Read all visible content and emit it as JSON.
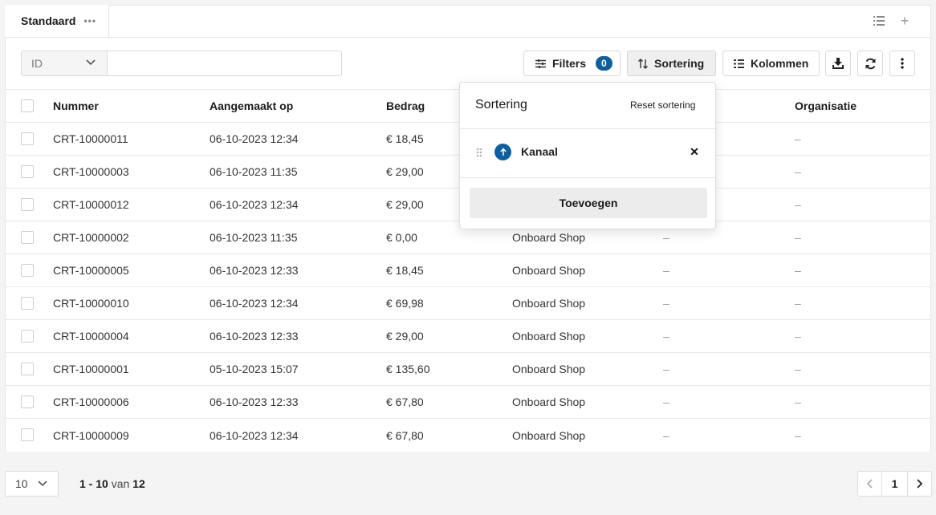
{
  "tabs": {
    "active_label": "Standaard",
    "more_label": "•••",
    "list_icon": "list-icon",
    "add_icon": "plus-icon",
    "add_label": "+"
  },
  "toolbar": {
    "field_select_value": "ID",
    "search_placeholder": "",
    "filters_label": "Filters",
    "filters_count": "0",
    "sort_label": "Sortering",
    "columns_label": "Kolommen",
    "download_icon": "download-icon",
    "refresh_icon": "refresh-icon",
    "more_icon": "vertical-dots-icon",
    "accent_color": "#0f5f9e"
  },
  "table": {
    "headers": {
      "number": "Nummer",
      "created": "Aangemaakt op",
      "amount": "Bedrag",
      "organisation": "Organisatie"
    },
    "rows": [
      {
        "number": "CRT-10000011",
        "created": "06-10-2023 12:34",
        "amount": "€ 18,45",
        "channel": "",
        "col5": "",
        "org": "–"
      },
      {
        "number": "CRT-10000003",
        "created": "06-10-2023 11:35",
        "amount": "€ 29,00",
        "channel": "",
        "col5": "",
        "org": "–"
      },
      {
        "number": "CRT-10000012",
        "created": "06-10-2023 12:34",
        "amount": "€ 29,00",
        "channel": "",
        "col5": "",
        "org": "–"
      },
      {
        "number": "CRT-10000002",
        "created": "06-10-2023 11:35",
        "amount": "€ 0,00",
        "channel": "Onboard Shop",
        "col5": "–",
        "org": "–"
      },
      {
        "number": "CRT-10000005",
        "created": "06-10-2023 12:33",
        "amount": "€ 18,45",
        "channel": "Onboard Shop",
        "col5": "–",
        "org": "–"
      },
      {
        "number": "CRT-10000010",
        "created": "06-10-2023 12:34",
        "amount": "€ 69,98",
        "channel": "Onboard Shop",
        "col5": "–",
        "org": "–"
      },
      {
        "number": "CRT-10000004",
        "created": "06-10-2023 12:33",
        "amount": "€ 29,00",
        "channel": "Onboard Shop",
        "col5": "–",
        "org": "–"
      },
      {
        "number": "CRT-10000001",
        "created": "05-10-2023 15:07",
        "amount": "€ 135,60",
        "channel": "Onboard Shop",
        "col5": "–",
        "org": "–"
      },
      {
        "number": "CRT-10000006",
        "created": "06-10-2023 12:33",
        "amount": "€ 67,80",
        "channel": "Onboard Shop",
        "col5": "–",
        "org": "–"
      },
      {
        "number": "CRT-10000009",
        "created": "06-10-2023 12:34",
        "amount": "€ 67,80",
        "channel": "Onboard Shop",
        "col5": "–",
        "org": "–"
      }
    ]
  },
  "sort_popover": {
    "title": "Sortering",
    "reset_label": "Reset sortering",
    "rule_label": "Kanaal",
    "rule_direction": "ascending",
    "remove_label": "✕",
    "add_label": "Toevoegen"
  },
  "footer": {
    "page_size": "10",
    "range_start_end": "1 - 10",
    "range_of": "van",
    "range_total": "12",
    "current_page": "1"
  }
}
